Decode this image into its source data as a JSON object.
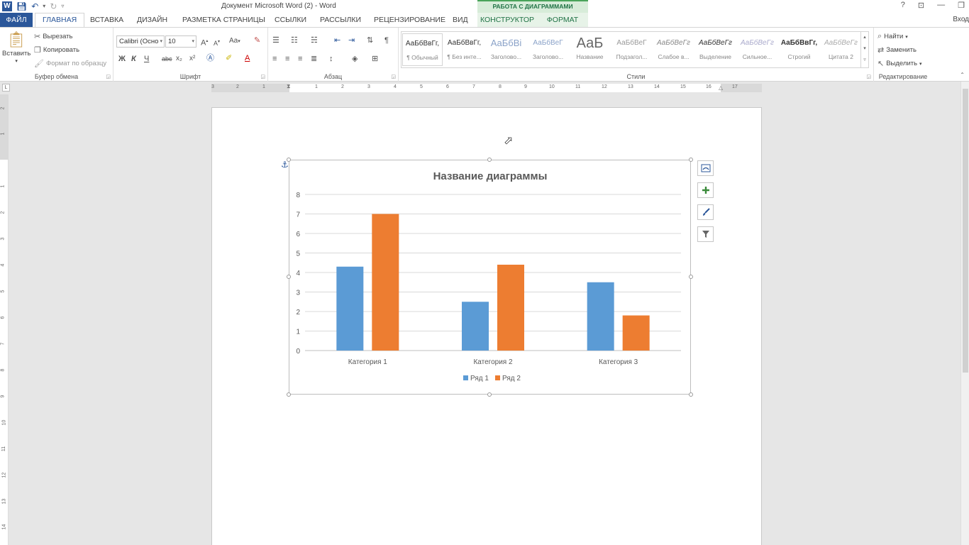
{
  "window": {
    "title": "Документ Microsoft Word (2) - Word",
    "help": "?",
    "controls": [
      "⊡",
      "—",
      "❐"
    ],
    "chart_tools_header": "РАБОТА С ДИАГРАММАМИ",
    "user": "Вход"
  },
  "tabs": {
    "file": "ФАЙЛ",
    "home": "ГЛАВНАЯ",
    "insert": "ВСТАВКА",
    "design": "ДИЗАЙН",
    "layout": "РАЗМЕТКА СТРАНИЦЫ",
    "references": "ССЫЛКИ",
    "mailings": "РАССЫЛКИ",
    "review": "РЕЦЕНЗИРОВАНИЕ",
    "view": "ВИД",
    "constructor": "КОНСТРУКТОР",
    "format": "ФОРМАТ"
  },
  "ribbon": {
    "clipboard": {
      "label": "Буфер обмена",
      "paste": "Вставить",
      "cut": "Вырезать",
      "copy": "Копировать",
      "format_painter": "Формат по образцу"
    },
    "font": {
      "label": "Шрифт",
      "font_name": "Calibri (Осно",
      "font_size": "10",
      "bold": "Ж",
      "italic": "К",
      "underline": "Ч",
      "strike": "abc",
      "subscript": "x₂",
      "superscript": "x²",
      "change_case": "Aa",
      "grow": "A",
      "shrink": "A"
    },
    "paragraph": {
      "label": "Абзац"
    },
    "styles": {
      "label": "Стили",
      "items": [
        {
          "sample": "АаБбВвГг,",
          "name": "¶ Обычный"
        },
        {
          "sample": "АаБбВвГг,",
          "name": "¶ Без инте..."
        },
        {
          "sample": "АаБбВі",
          "name": "Заголово..."
        },
        {
          "sample": "АаБбВеГ",
          "name": "Заголово..."
        },
        {
          "sample": "АаБ",
          "name": "Название"
        },
        {
          "sample": "АаБбВеГ",
          "name": "Подзагол..."
        },
        {
          "sample": "АаБбВеГг",
          "name": "Слабое в..."
        },
        {
          "sample": "АаБбВеГг",
          "name": "Выделение"
        },
        {
          "sample": "АаБбВеГг",
          "name": "Сильное..."
        },
        {
          "sample": "АаБбВвГг,",
          "name": "Строгий"
        },
        {
          "sample": "АаБбВеГг",
          "name": "Цитата 2"
        }
      ]
    },
    "editing": {
      "label": "Редактирование",
      "find": "Найти",
      "replace": "Заменить",
      "select": "Выделить"
    }
  },
  "ruler": {
    "h_ticks": [
      "3",
      "2",
      "1",
      "1",
      "2",
      "3",
      "4",
      "5",
      "6",
      "7",
      "8",
      "9",
      "10",
      "11",
      "12",
      "13",
      "14",
      "15",
      "16",
      "17"
    ],
    "v_ticks": [
      "2",
      "1",
      "1",
      "2",
      "3",
      "4",
      "5",
      "6",
      "7",
      "8",
      "9",
      "10",
      "11",
      "12",
      "13",
      "14"
    ],
    "corner": "L"
  },
  "chart_data": {
    "type": "bar",
    "title": "Название диаграммы",
    "categories": [
      "Категория 1",
      "Категория 2",
      "Категория 3"
    ],
    "series": [
      {
        "name": "Ряд 1",
        "values": [
          4.3,
          2.5,
          3.5
        ],
        "color": "#5b9bd5"
      },
      {
        "name": "Ряд 2",
        "values": [
          7,
          4.4,
          1.8
        ],
        "color": "#ed7d31"
      }
    ],
    "ylim": [
      0,
      8
    ],
    "yticks": [
      "0",
      "1",
      "2",
      "3",
      "4",
      "5",
      "6",
      "7",
      "8"
    ],
    "grid": true,
    "legend": "bottom"
  }
}
